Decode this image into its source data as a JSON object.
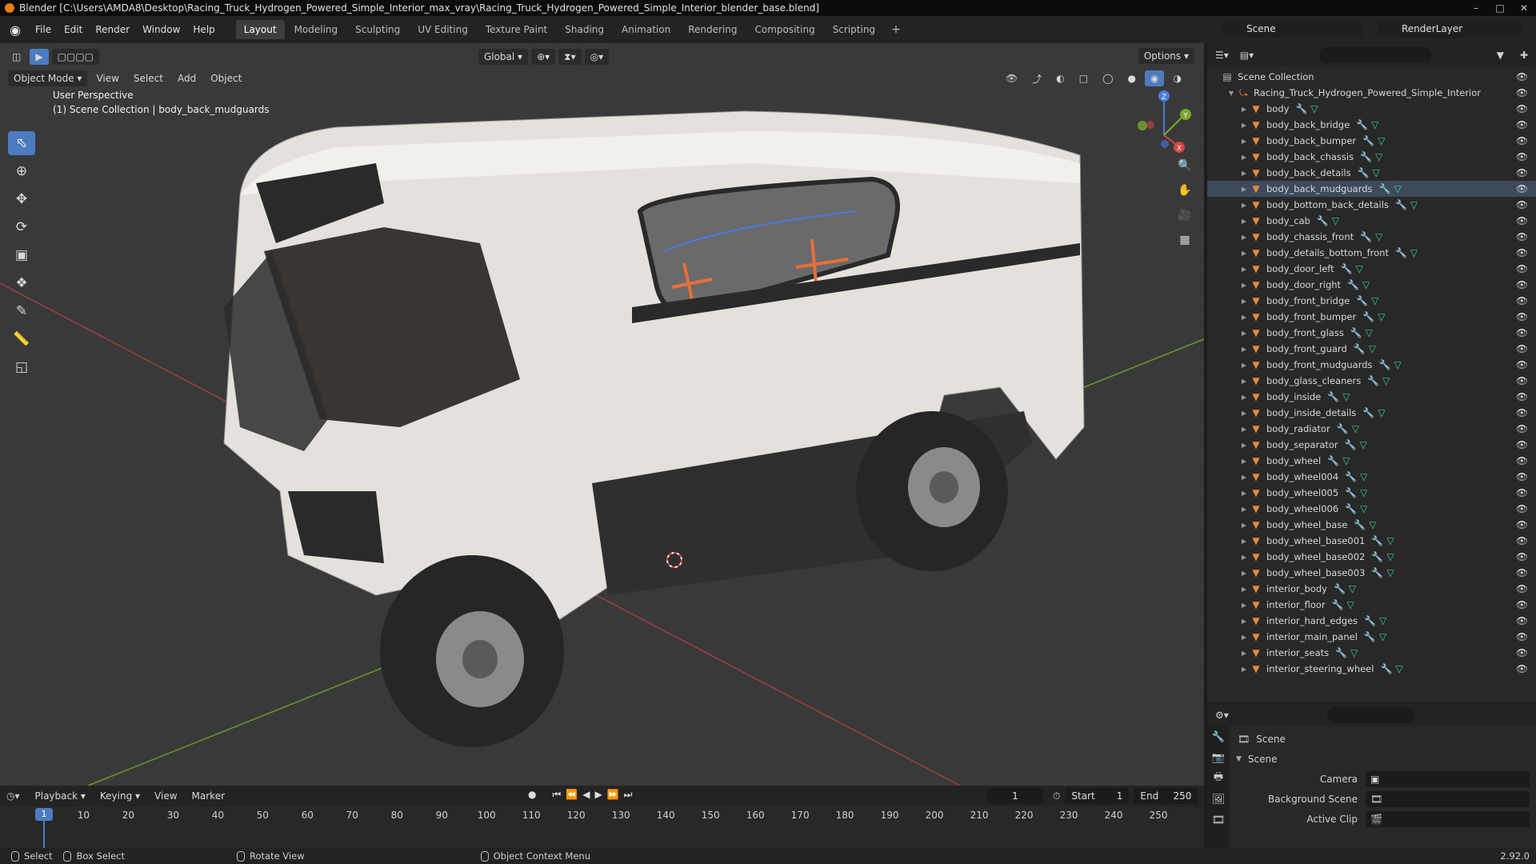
{
  "window": {
    "title": "Blender [C:\\Users\\AMDA8\\Desktop\\Racing_Truck_Hydrogen_Powered_Simple_Interior_max_vray\\Racing_Truck_Hydrogen_Powered_Simple_Interior_blender_base.blend]",
    "minimize": "–",
    "maximize": "□",
    "close": "✕"
  },
  "menu": [
    "File",
    "Edit",
    "Render",
    "Window",
    "Help"
  ],
  "workspaces": [
    "Layout",
    "Modeling",
    "Sculpting",
    "UV Editing",
    "Texture Paint",
    "Shading",
    "Animation",
    "Rendering",
    "Compositing",
    "Scripting"
  ],
  "workspace_add": "+",
  "scene_name": "Scene",
  "view_layer": "RenderLayer",
  "viewport": {
    "mode": "Object Mode",
    "menus": [
      "View",
      "Select",
      "Add",
      "Object"
    ],
    "transform_orientation": "Global",
    "options": "Options",
    "perspective_label": "User Perspective",
    "collection_label": "(1) Scene Collection | body_back_mudguards",
    "gizmo": {
      "x": "X",
      "y": "Y",
      "z": "Z"
    }
  },
  "outliner": {
    "root": "Scene Collection",
    "collection": "Racing_Truck_Hydrogen_Powered_Simple_Interior",
    "selected": "body_back_mudguards",
    "objects": [
      "body",
      "body_back_bridge",
      "body_back_bumper",
      "body_back_chassis",
      "body_back_details",
      "body_back_mudguards",
      "body_bottom_back_details",
      "body_cab",
      "body_chassis_front",
      "body_details_bottom_front",
      "body_door_left",
      "body_door_right",
      "body_front_bridge",
      "body_front_bumper",
      "body_front_glass",
      "body_front_guard",
      "body_front_mudguards",
      "body_glass_cleaners",
      "body_inside",
      "body_inside_details",
      "body_radiator",
      "body_separator",
      "body_wheel",
      "body_wheel004",
      "body_wheel005",
      "body_wheel006",
      "body_wheel_base",
      "body_wheel_base001",
      "body_wheel_base002",
      "body_wheel_base003",
      "interior_body",
      "interior_floor",
      "interior_hard_edges",
      "interior_main_panel",
      "interior_seats",
      "interior_steering_wheel"
    ]
  },
  "properties": {
    "context": "Scene",
    "panel": "Scene",
    "camera_label": "Camera",
    "background_label": "Background Scene",
    "clip_label": "Active Clip"
  },
  "timeline": {
    "menus": [
      "Playback",
      "Keying",
      "View",
      "Marker"
    ],
    "current_frame": "1",
    "start_label": "Start",
    "start": "1",
    "end_label": "End",
    "end": "250",
    "ticks": [
      "1",
      "10",
      "20",
      "30",
      "40",
      "50",
      "60",
      "70",
      "80",
      "90",
      "100",
      "110",
      "120",
      "130",
      "140",
      "150",
      "160",
      "170",
      "180",
      "190",
      "200",
      "210",
      "220",
      "230",
      "240",
      "250"
    ]
  },
  "statusbar": {
    "select": "Select",
    "box_select": "Box Select",
    "rotate": "Rotate View",
    "context_menu": "Object Context Menu",
    "version": "2.92.0"
  },
  "colors": {
    "accent": "#4d7bc0",
    "object_icon": "#e58a3a",
    "modifier_icon": "#6a9eea",
    "mesh_icon": "#3ec9a5",
    "grid_x": "#c94444",
    "grid_y": "#7aa830"
  }
}
